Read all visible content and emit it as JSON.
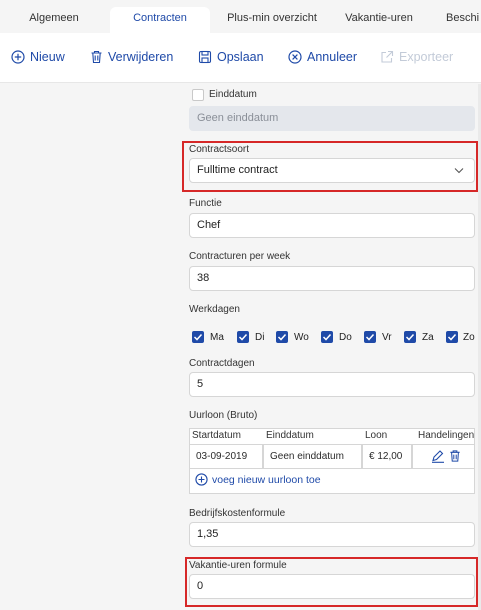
{
  "tabs": [
    {
      "label": "Algemeen"
    },
    {
      "label": "Contracten"
    },
    {
      "label": "Plus-min overzicht"
    },
    {
      "label": "Vakantie-uren"
    },
    {
      "label": "Beschi"
    }
  ],
  "toolbar": {
    "new_label": "Nieuw",
    "delete_label": "Verwijderen",
    "save_label": "Opslaan",
    "cancel_label": "Annuleer",
    "export_label": "Exporteer"
  },
  "form": {
    "einddatum_label": "Einddatum",
    "einddatum_checked": false,
    "einddatum_value": "Geen einddatum",
    "contractsoort_label": "Contractsoort",
    "contractsoort_value": "Fulltime contract",
    "functie_label": "Functie",
    "functie_value": "Chef",
    "contracturen_label": "Contracturen per week",
    "contracturen_value": "38",
    "werkdagen_label": "Werkdagen",
    "werkdagen": [
      {
        "label": "Ma",
        "checked": true
      },
      {
        "label": "Di",
        "checked": true
      },
      {
        "label": "Wo",
        "checked": true
      },
      {
        "label": "Do",
        "checked": true
      },
      {
        "label": "Vr",
        "checked": true
      },
      {
        "label": "Za",
        "checked": true
      },
      {
        "label": "Zo",
        "checked": true
      }
    ],
    "contractdagen_label": "Contractdagen",
    "contractdagen_value": "5",
    "uurloon_label": "Uurloon (Bruto)",
    "uurloon_table": {
      "headers": [
        "Startdatum",
        "Einddatum",
        "Loon",
        "Handelingen"
      ],
      "rows": [
        {
          "startdatum": "03-09-2019",
          "einddatum": "Geen einddatum",
          "loon": "€ 12,00"
        }
      ],
      "add_label": "voeg nieuw uurloon toe"
    },
    "bedrijfskosten_label": "Bedrijfskostenformule",
    "bedrijfskosten_value": "1,35",
    "vakantie_label": "Vakantie-uren formule",
    "vakantie_value": "0"
  },
  "colors": {
    "accent": "#1f4aa8",
    "highlight": "#d62828"
  }
}
